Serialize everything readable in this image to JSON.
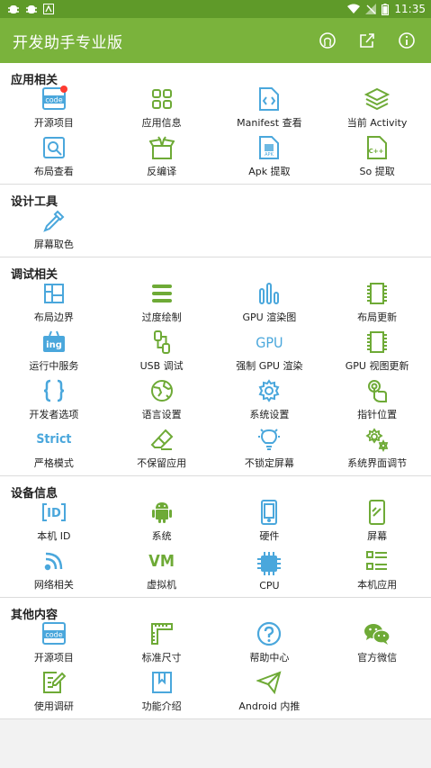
{
  "status_bar": {
    "time": "11:35"
  },
  "app_bar": {
    "title": "开发助手专业版"
  },
  "colors": {
    "appbar": "#7ab33c",
    "statusbar": "#5f9a29",
    "icon_blue": "#4aa7dc",
    "icon_green": "#6eaa36"
  },
  "sections": [
    {
      "title": "应用相关",
      "items": [
        {
          "label": "开源项目",
          "icon": "code-icon"
        },
        {
          "label": "应用信息",
          "icon": "grid-icon"
        },
        {
          "label": "Manifest 查看",
          "icon": "xml-file-icon"
        },
        {
          "label": "当前 Activity",
          "icon": "layers-icon"
        },
        {
          "label": "布局查看",
          "icon": "layout-search-icon"
        },
        {
          "label": "反编译",
          "icon": "box-open-icon"
        },
        {
          "label": "Apk 提取",
          "icon": "apk-file-icon"
        },
        {
          "label": "So 提取",
          "icon": "cpp-file-icon"
        }
      ]
    },
    {
      "title": "设计工具",
      "items": [
        {
          "label": "屏幕取色",
          "icon": "eyedropper-icon"
        }
      ]
    },
    {
      "title": "调试相关",
      "items": [
        {
          "label": "布局边界",
          "icon": "layout-bounds-icon"
        },
        {
          "label": "过度绘制",
          "icon": "overdraw-icon"
        },
        {
          "label": "GPU 渲染图",
          "icon": "bar-chart-icon"
        },
        {
          "label": "布局更新",
          "icon": "chip-outline-icon"
        },
        {
          "label": "运行中服务",
          "icon": "running-service-icon"
        },
        {
          "label": "USB 调试",
          "icon": "usb-icon"
        },
        {
          "label": "强制 GPU 渲染",
          "icon": "gpu-text-icon"
        },
        {
          "label": "GPU 视图更新",
          "icon": "chip-outline-green-icon"
        },
        {
          "label": "开发者选项",
          "icon": "braces-icon"
        },
        {
          "label": "语言设置",
          "icon": "globe-icon"
        },
        {
          "label": "系统设置",
          "icon": "gear-icon"
        },
        {
          "label": "指针位置",
          "icon": "pointer-icon"
        },
        {
          "label": "严格模式",
          "icon": "strict-text-icon"
        },
        {
          "label": "不保留应用",
          "icon": "eraser-icon"
        },
        {
          "label": "不锁定屏幕",
          "icon": "bulb-icon"
        },
        {
          "label": "系统界面调节",
          "icon": "gears-icon"
        }
      ]
    },
    {
      "title": "设备信息",
      "items": [
        {
          "label": "本机 ID",
          "icon": "id-icon"
        },
        {
          "label": "系统",
          "icon": "android-icon"
        },
        {
          "label": "硬件",
          "icon": "phone-icon"
        },
        {
          "label": "屏幕",
          "icon": "screen-icon"
        },
        {
          "label": "网络相关",
          "icon": "wifi-icon"
        },
        {
          "label": "虚拟机",
          "icon": "vm-text-icon"
        },
        {
          "label": "CPU",
          "icon": "cpu-icon"
        },
        {
          "label": "本机应用",
          "icon": "app-list-icon"
        }
      ]
    },
    {
      "title": "其他内容",
      "items": [
        {
          "label": "开源项目",
          "icon": "code-icon"
        },
        {
          "label": "标准尺寸",
          "icon": "ruler-icon"
        },
        {
          "label": "帮助中心",
          "icon": "help-icon"
        },
        {
          "label": "官方微信",
          "icon": "wechat-icon"
        },
        {
          "label": "使用调研",
          "icon": "survey-icon"
        },
        {
          "label": "功能介绍",
          "icon": "bookmark-icon"
        },
        {
          "label": "Android 内推",
          "icon": "send-icon"
        }
      ]
    }
  ],
  "icon_text": {
    "code": "code",
    "gpu": "GPU",
    "strict": "Strict",
    "vm": "VM",
    "id": "ID",
    "ing": "ing",
    "apk": "APK",
    "cpp": "C++"
  }
}
